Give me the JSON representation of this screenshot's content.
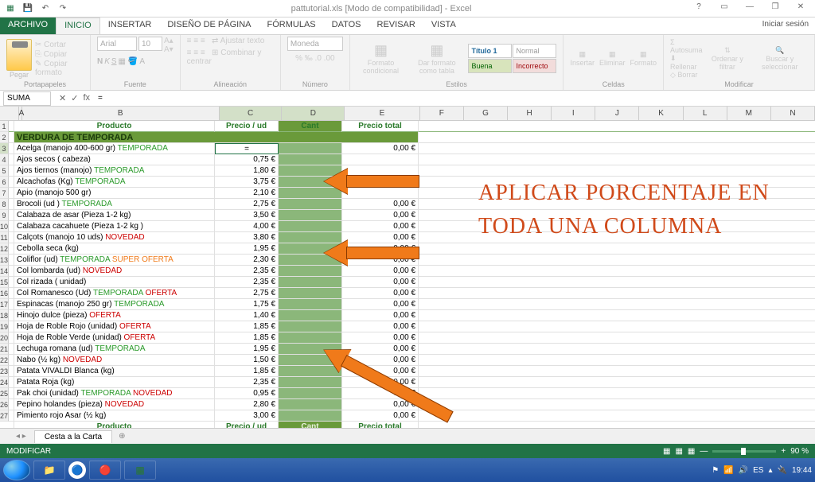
{
  "app": {
    "title": "pattutorial.xls  [Modo de compatibilidad] - Excel",
    "signin": "Iniciar sesión"
  },
  "tabs": {
    "file": "ARCHIVO",
    "home": "INICIO",
    "insert": "INSERTAR",
    "layout": "DISEÑO DE PÁGINA",
    "formulas": "FÓRMULAS",
    "data": "DATOS",
    "review": "REVISAR",
    "view": "VISTA"
  },
  "ribbon": {
    "clipboard": {
      "label": "Portapapeles",
      "paste": "Pegar",
      "cut": "Cortar",
      "copy": "Copiar",
      "brush": "Copiar formato"
    },
    "font": {
      "label": "Fuente",
      "name": "Arial",
      "size": "10"
    },
    "align": {
      "label": "Alineación",
      "wrap": "Ajustar texto",
      "merge": "Combinar y centrar"
    },
    "number": {
      "label": "Número",
      "format": "Moneda"
    },
    "styles": {
      "label": "Estilos",
      "cond": "Formato condicional",
      "table": "Dar formato como tabla",
      "t1": "Título 1",
      "normal": "Normal",
      "buena": "Buena",
      "incorrecto": "Incorrecto"
    },
    "cells": {
      "label": "Celdas",
      "insert": "Insertar",
      "delete": "Eliminar",
      "format": "Formato"
    },
    "editing": {
      "label": "Modificar",
      "sum": "Autosuma",
      "fill": "Rellenar",
      "clear": "Borrar",
      "sort": "Ordenar y filtrar",
      "find": "Buscar y seleccionar"
    }
  },
  "formula": {
    "name": "SUMA",
    "fx": "fx",
    "value": "="
  },
  "columns": [
    "A",
    "B",
    "C",
    "D",
    "E",
    "F",
    "G",
    "H",
    "I",
    "J",
    "K",
    "L",
    "M",
    "N"
  ],
  "headers": {
    "producto": "Producto",
    "precio": "Precio / ud",
    "cant": "Cant",
    "total": "Precio total"
  },
  "section": "VERDURA DE  TEMPORADA",
  "active_cell": "=",
  "rows": [
    {
      "n": 3,
      "prod": "Acelga  (manojo 400-600 gr)",
      "tag1": "TEMPORADA",
      "price": "",
      "total": "0,00 €",
      "active": true
    },
    {
      "n": 4,
      "prod": "Ajos secos ( cabeza)",
      "price": "0,75 €",
      "total": ""
    },
    {
      "n": 5,
      "prod": "Ajos tiernos (manojo)",
      "tag1": "TEMPORADA",
      "price": "1,80 €",
      "total": ""
    },
    {
      "n": 6,
      "prod": "Alcachofas (Kg)",
      "tag1": "TEMPORADA",
      "price": "3,75 €",
      "total": ""
    },
    {
      "n": 7,
      "prod": "Apio (manojo 500 gr)",
      "price": "2,10 €",
      "total": ""
    },
    {
      "n": 8,
      "prod": "Brocoli (ud )",
      "tag1": "TEMPORADA",
      "price": "2,75 €",
      "total": "0,00 €"
    },
    {
      "n": 9,
      "prod": "Calabaza de asar (Pieza 1-2 kg)",
      "price": "3,50 €",
      "total": "0,00 €"
    },
    {
      "n": 10,
      "prod": "Calabaza cacahuete (Pieza 1-2 kg )",
      "price": "4,00 €",
      "total": "0,00 €"
    },
    {
      "n": 11,
      "prod": "Calçots  (manojo 10 uds)",
      "tag2": "NOVEDAD",
      "price": "3,80 €",
      "total": "0,00 €"
    },
    {
      "n": 12,
      "prod": "Cebolla seca (kg)",
      "price": "1,95 €",
      "total": "0,00 €"
    },
    {
      "n": 13,
      "prod": "Coliflor (ud)",
      "tag1": "TEMPORADA",
      "tag3": "SUPER OFERTA",
      "price": "2,30 €",
      "total": "0,00 €"
    },
    {
      "n": 14,
      "prod": "Col lombarda (ud)",
      "tag2": "NOVEDAD",
      "price": "2,35 €",
      "total": "0,00 €"
    },
    {
      "n": 15,
      "prod": "Col rizada ( unidad)",
      "price": "2,35 €",
      "total": "0,00 €"
    },
    {
      "n": 16,
      "prod": "Col Romanesco (Ud)",
      "tag1": "TEMPORADA",
      "tag4": "OFERTA",
      "price": "2,75 €",
      "total": "0,00 €"
    },
    {
      "n": 17,
      "prod": "Espinacas (manojo 250 gr)",
      "tag1": "TEMPORADA",
      "price": "1,75 €",
      "total": "0,00 €"
    },
    {
      "n": 18,
      "prod": "Hinojo dulce (pieza)",
      "tag4": "OFERTA",
      "price": "1,40 €",
      "total": "0,00 €"
    },
    {
      "n": 19,
      "prod": "Hoja de Roble Rojo (unidad)",
      "tag4": "OFERTA",
      "price": "1,85 €",
      "total": "0,00 €"
    },
    {
      "n": 20,
      "prod": "Hoja de Roble Verde  (unidad)",
      "tag4": "OFERTA",
      "price": "1,85 €",
      "total": "0,00 €"
    },
    {
      "n": 21,
      "prod": "Lechuga romana (ud)",
      "tag1": "TEMPORADA",
      "price": "1,95 €",
      "total": "0,00 €"
    },
    {
      "n": 22,
      "prod": "Nabo (½ kg)",
      "tag2": "NOVEDAD",
      "price": "1,50 €",
      "total": "0,00 €"
    },
    {
      "n": 23,
      "prod": "Patata VIVALDI Blanca (kg)",
      "price": "1,85 €",
      "total": "0,00 €"
    },
    {
      "n": 24,
      "prod": "Patata Roja (kg)",
      "price": "2,35 €",
      "total": "0,00 €"
    },
    {
      "n": 25,
      "prod": "Pak choi (unidad)",
      "tag1": "TEMPORADA",
      "tag2": "NOVEDAD",
      "price": "0,95 €",
      "total": "0,00 €"
    },
    {
      "n": 26,
      "prod": "Pepino holandes (pieza)",
      "tag2": "NOVEDAD",
      "price": "2,80 €",
      "total": "0,00 €"
    },
    {
      "n": 27,
      "prod": "Pimiento rojo Asar  (½ kg)",
      "price": "3,00 €",
      "total": "0,00 €"
    }
  ],
  "overlay": "Aplicar porcentaje en toda una columna",
  "sheet_tab": "Cesta a la Carta",
  "status": {
    "mode": "MODIFICAR",
    "zoom": "90 %"
  },
  "taskbar": {
    "time": "19:44"
  }
}
